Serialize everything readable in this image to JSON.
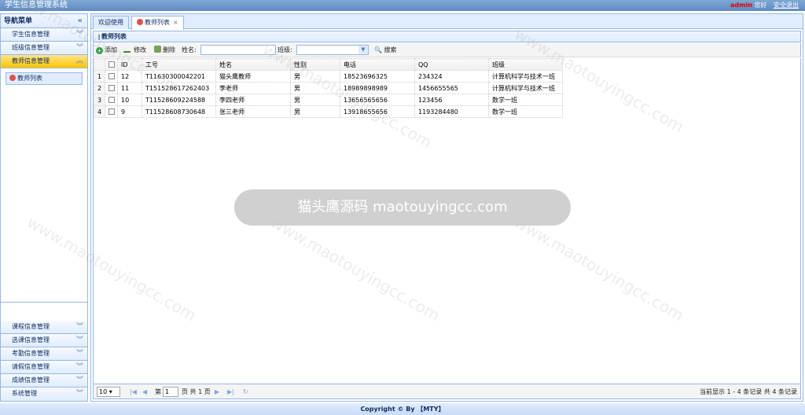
{
  "header": {
    "title": "学生信息管理系统",
    "user": "admin",
    "greeting": "您好",
    "logout": "安全退出"
  },
  "nav": {
    "title": "导航菜单",
    "top_sections": [
      "学生信息管理",
      "班级信息管理",
      "教师信息管理"
    ],
    "active_item": "教师列表",
    "bottom_sections": [
      "课程信息管理",
      "选课信息管理",
      "考勤信息管理",
      "请假信息管理",
      "成绩信息管理",
      "系统管理"
    ]
  },
  "tabs": {
    "welcome": "欢迎使用",
    "teachers": "教师列表",
    "close": "×"
  },
  "panel": {
    "title": "教师列表"
  },
  "toolbar": {
    "add": "添加",
    "edit": "修改",
    "delete": "删除",
    "name_label": "姓名:",
    "class_label": "班级:",
    "search": "搜索"
  },
  "grid": {
    "columns": [
      "ID",
      "工号",
      "姓名",
      "性别",
      "电话",
      "QQ",
      "班级"
    ],
    "rows": [
      [
        "1",
        "12",
        "T11630300042201",
        "猫头鹰教师",
        "男",
        "18523696325",
        "234324",
        "计算机科学与技术一班"
      ],
      [
        "2",
        "11",
        "T151528617262403",
        "李老师",
        "男",
        "18989898989",
        "1456655565",
        "计算机科学与技术一班"
      ],
      [
        "3",
        "10",
        "T11528609224588",
        "李四老师",
        "男",
        "13656565656",
        "123456",
        "数学一班"
      ],
      [
        "4",
        "9",
        "T11528608730648",
        "张三老师",
        "男",
        "13918655656",
        "1193284480",
        "数学一班"
      ]
    ]
  },
  "pager": {
    "page_size": "10",
    "page_label": "第",
    "page_value": "1",
    "total_label": "页 共 1 页",
    "summary": "当前显示 1 - 4 条记录 共 4 条记录"
  },
  "footer": {
    "text": "Copyright © By 【MTY】"
  },
  "watermark": {
    "banner": "猫头鹰源码 maotouyingcc.com",
    "text": "www.maotouyingcc.com"
  }
}
